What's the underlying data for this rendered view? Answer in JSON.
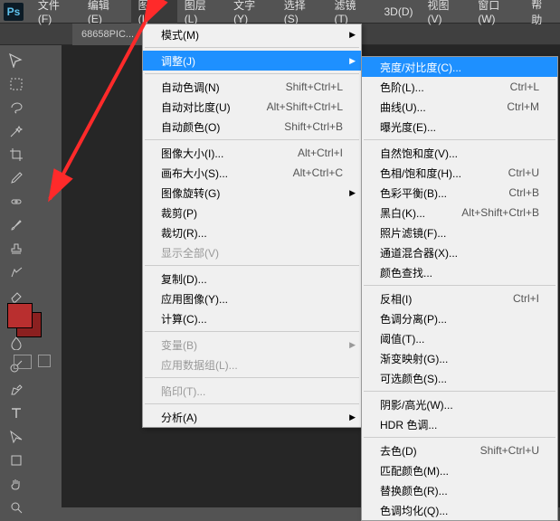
{
  "app": {
    "logo": "Ps"
  },
  "menubar": [
    {
      "label": "文件(F)"
    },
    {
      "label": "编辑(E)"
    },
    {
      "label": "图像(I)",
      "active": true
    },
    {
      "label": "图层(L)"
    },
    {
      "label": "文字(Y)"
    },
    {
      "label": "选择(S)"
    },
    {
      "label": "滤镜(T)"
    },
    {
      "label": "3D(D)"
    },
    {
      "label": "视图(V)"
    },
    {
      "label": "窗口(W)"
    },
    {
      "label": "帮助"
    }
  ],
  "tabs": [
    {
      "label": "68658PIC..."
    }
  ],
  "image_menu": {
    "groups": [
      [
        {
          "label": "模式(M)",
          "sub": true
        }
      ],
      [
        {
          "label": "调整(J)",
          "sub": true,
          "hl": true
        }
      ],
      [
        {
          "label": "自动色调(N)",
          "shortcut": "Shift+Ctrl+L"
        },
        {
          "label": "自动对比度(U)",
          "shortcut": "Alt+Shift+Ctrl+L"
        },
        {
          "label": "自动颜色(O)",
          "shortcut": "Shift+Ctrl+B"
        }
      ],
      [
        {
          "label": "图像大小(I)...",
          "shortcut": "Alt+Ctrl+I"
        },
        {
          "label": "画布大小(S)...",
          "shortcut": "Alt+Ctrl+C"
        },
        {
          "label": "图像旋转(G)",
          "sub": true
        },
        {
          "label": "裁剪(P)"
        },
        {
          "label": "裁切(R)..."
        },
        {
          "label": "显示全部(V)",
          "disabled": true
        }
      ],
      [
        {
          "label": "复制(D)..."
        },
        {
          "label": "应用图像(Y)..."
        },
        {
          "label": "计算(C)..."
        }
      ],
      [
        {
          "label": "变量(B)",
          "sub": true,
          "disabled": true
        },
        {
          "label": "应用数据组(L)...",
          "disabled": true
        }
      ],
      [
        {
          "label": "陷印(T)...",
          "disabled": true
        }
      ],
      [
        {
          "label": "分析(A)",
          "sub": true
        }
      ]
    ]
  },
  "adjust_menu": {
    "groups": [
      [
        {
          "label": "亮度/对比度(C)...",
          "hl": true
        },
        {
          "label": "色阶(L)...",
          "shortcut": "Ctrl+L"
        },
        {
          "label": "曲线(U)...",
          "shortcut": "Ctrl+M"
        },
        {
          "label": "曝光度(E)..."
        }
      ],
      [
        {
          "label": "自然饱和度(V)..."
        },
        {
          "label": "色相/饱和度(H)...",
          "shortcut": "Ctrl+U"
        },
        {
          "label": "色彩平衡(B)...",
          "shortcut": "Ctrl+B"
        },
        {
          "label": "黑白(K)...",
          "shortcut": "Alt+Shift+Ctrl+B"
        },
        {
          "label": "照片滤镜(F)..."
        },
        {
          "label": "通道混合器(X)..."
        },
        {
          "label": "颜色查找..."
        }
      ],
      [
        {
          "label": "反相(I)",
          "shortcut": "Ctrl+I"
        },
        {
          "label": "色调分离(P)..."
        },
        {
          "label": "阈值(T)..."
        },
        {
          "label": "渐变映射(G)..."
        },
        {
          "label": "可选颜色(S)..."
        }
      ],
      [
        {
          "label": "阴影/高光(W)..."
        },
        {
          "label": "HDR 色调..."
        }
      ],
      [
        {
          "label": "去色(D)",
          "shortcut": "Shift+Ctrl+U"
        },
        {
          "label": "匹配颜色(M)..."
        },
        {
          "label": "替换颜色(R)..."
        },
        {
          "label": "色调均化(Q)..."
        }
      ]
    ]
  },
  "tools": [
    "move",
    "marquee",
    "lasso",
    "wand",
    "crop",
    "eyedropper",
    "heal",
    "brush",
    "stamp",
    "history",
    "eraser",
    "gradient",
    "blur",
    "dodge",
    "pen",
    "type",
    "path",
    "shape",
    "hand",
    "zoom"
  ],
  "colors": {
    "fg": "#b92f2f",
    "bg": "#8b2020"
  }
}
